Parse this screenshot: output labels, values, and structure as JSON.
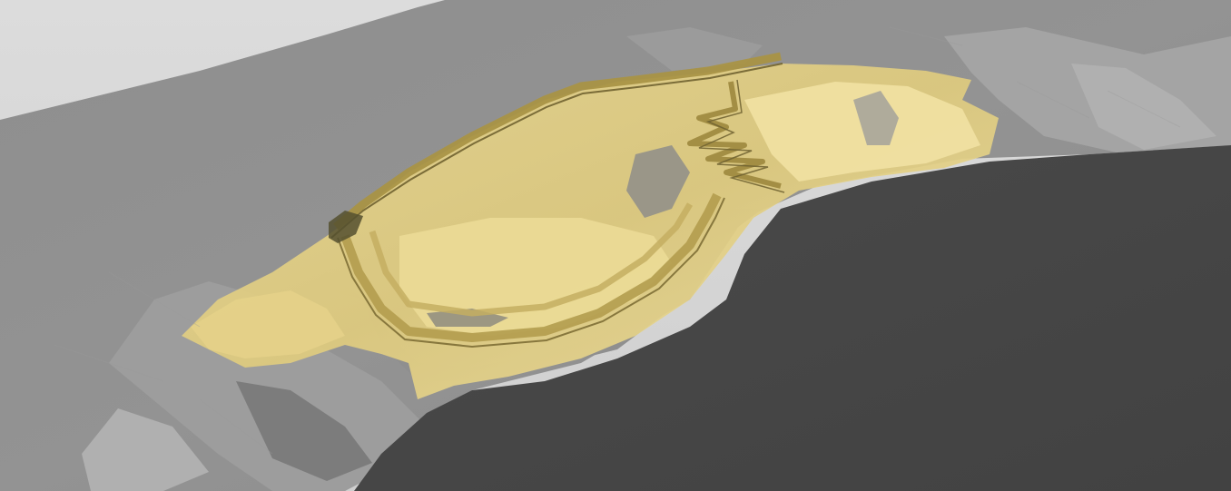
{
  "scene": {
    "kind": "3d-terrain-render",
    "description_visible_text": "",
    "colors": {
      "background": "#d8d8d8",
      "terrain_light": "#a3a3a3",
      "terrain_mid": "#8c8c8c",
      "terrain_dark": "#6e6e6e",
      "terrain_shadow": "#474747",
      "pit_surface": "#e2cf86",
      "pit_surface_light": "#efdf9c",
      "bench_dark": "#8a7a3e",
      "bench_mid": "#b9a35c"
    }
  }
}
